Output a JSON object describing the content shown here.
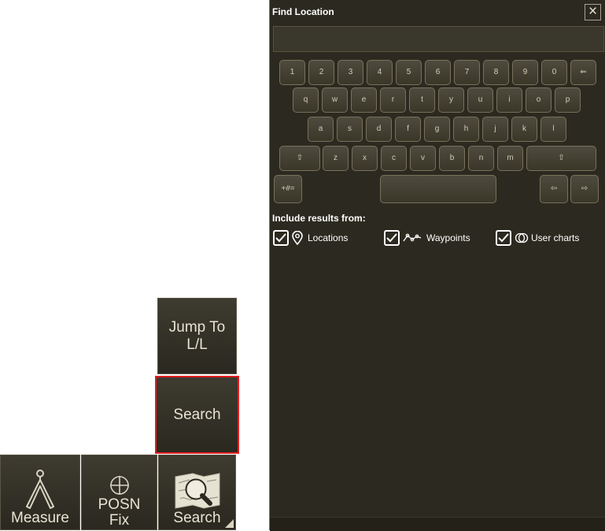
{
  "toolbar": {
    "jump_to": "Jump To\nL/L",
    "search_menu": "Search",
    "measure": "Measure",
    "posn_fix": "POSN\nFix",
    "search_bar": "Search",
    "icons": {
      "measure": "compass-divider-icon",
      "posn": "crosshair-circle-icon",
      "search": "chart-magnifier-icon"
    },
    "selected_outline_color": "#e41e22"
  },
  "dialog": {
    "title": "Find Location",
    "close_icon": "close-icon",
    "search_value": "",
    "keyboard": {
      "row1": [
        "1",
        "2",
        "3",
        "4",
        "5",
        "6",
        "7",
        "8",
        "9",
        "0",
        "⇐"
      ],
      "row2": [
        "q",
        "w",
        "e",
        "r",
        "t",
        "y",
        "u",
        "i",
        "o",
        "p"
      ],
      "row3": [
        "a",
        "s",
        "d",
        "f",
        "g",
        "h",
        "j",
        "k",
        "l"
      ],
      "row4": [
        "⇧",
        "z",
        "x",
        "c",
        "v",
        "b",
        "n",
        "m",
        "⇧"
      ],
      "row5": {
        "symbols": "+#=",
        "space": "",
        "left": "⇦",
        "right": "⇨"
      }
    },
    "include_label": "Include results from:",
    "options": [
      {
        "label": "Locations",
        "checked": true,
        "icon": "location-pin-icon"
      },
      {
        "label": "Waypoints",
        "checked": true,
        "icon": "route-icon"
      },
      {
        "label": "User charts",
        "checked": true,
        "icon": "overlapping-circles-icon"
      }
    ]
  }
}
